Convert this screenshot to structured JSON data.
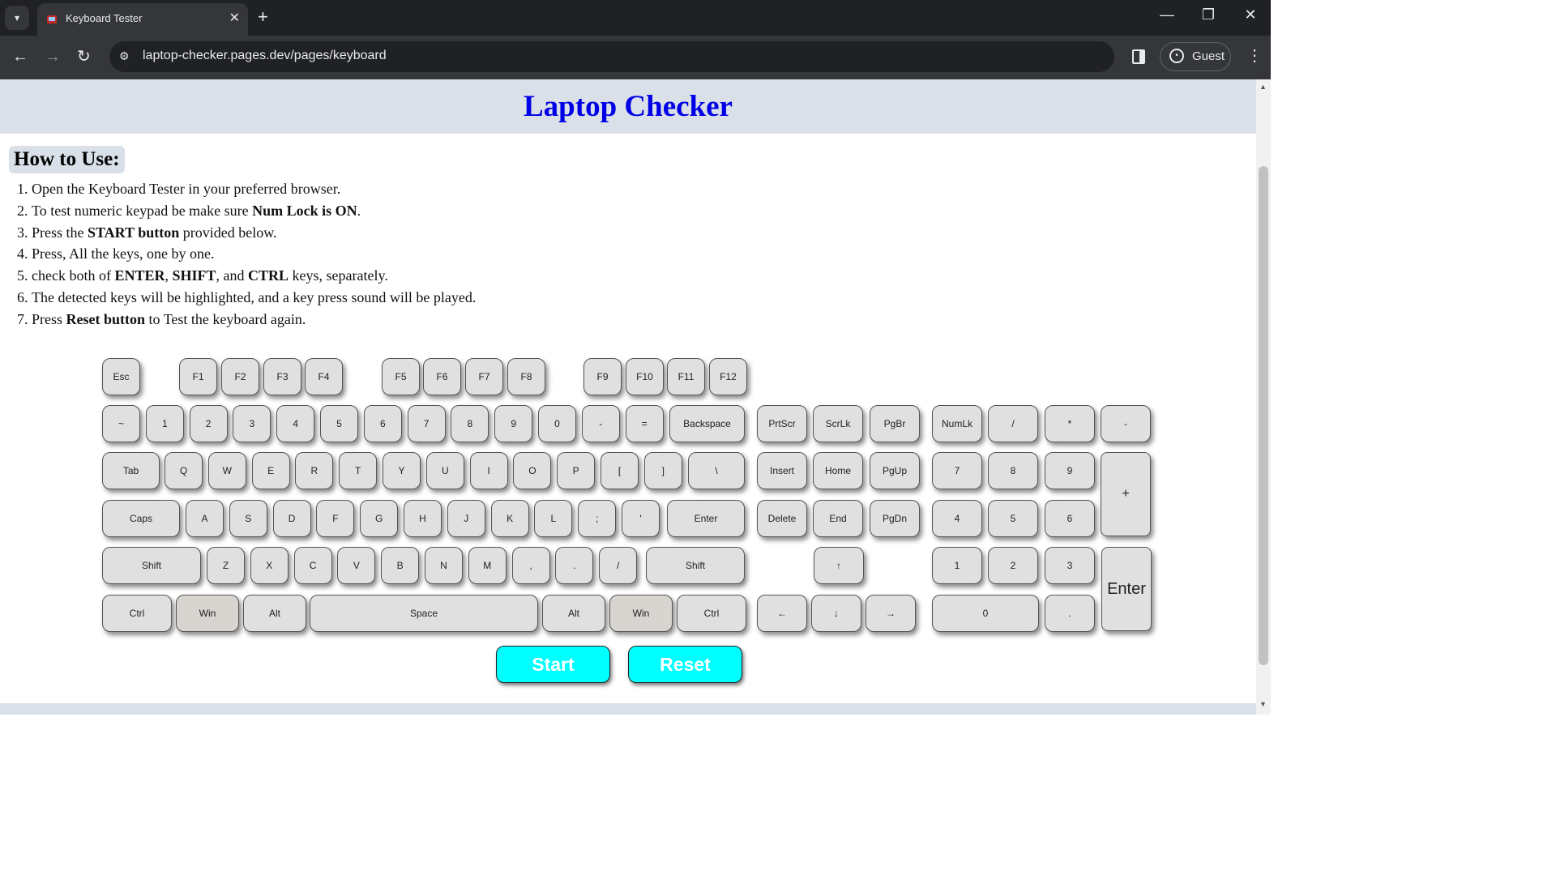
{
  "browser": {
    "tab_title": "Keyboard Tester",
    "tab_close": "✕",
    "new_tab": "+",
    "url": "laptop-checker.pages.dev/pages/keyboard",
    "profile_label": "Guest",
    "icons": [
      "tab-list-icon",
      "favicon",
      "close-icon",
      "plus-icon",
      "minimize-icon",
      "restore-icon",
      "window-close-icon",
      "back-icon",
      "forward-icon",
      "reload-icon",
      "site-info-icon",
      "side-panel-icon",
      "profile-icon",
      "menu-icon"
    ]
  },
  "page": {
    "title": "Laptop Checker",
    "howto_heading": "How to Use:",
    "steps": [
      [
        {
          "t": "Open the Keyboard Tester in your preferred browser."
        }
      ],
      [
        {
          "t": "To test numeric keypad be make sure "
        },
        {
          "b": "Num Lock is ON"
        },
        {
          "t": "."
        }
      ],
      [
        {
          "t": "Press the "
        },
        {
          "b": "START button"
        },
        {
          "t": " provided below."
        }
      ],
      [
        {
          "t": "Press, All the keys, one by one."
        }
      ],
      [
        {
          "t": "check both of "
        },
        {
          "b": "ENTER"
        },
        {
          "t": ", "
        },
        {
          "b": "SHIFT"
        },
        {
          "t": ", and "
        },
        {
          "b": "CTRL"
        },
        {
          "t": " keys, separately."
        }
      ],
      [
        {
          "t": "The detected keys will be highlighted, and a key press sound will be played."
        }
      ],
      [
        {
          "t": "Press "
        },
        {
          "b": "Reset button"
        },
        {
          "t": " to Test the keyboard again."
        }
      ]
    ],
    "keyboard": {
      "fn_row": [
        "Esc",
        "F1",
        "F2",
        "F3",
        "F4",
        "F5",
        "F6",
        "F7",
        "F8",
        "F9",
        "F10",
        "F11",
        "F12"
      ],
      "number_row": [
        "~",
        "1",
        "2",
        "3",
        "4",
        "5",
        "6",
        "7",
        "8",
        "9",
        "0",
        "-",
        "=",
        "Backspace"
      ],
      "tab_row": [
        "Tab",
        "Q",
        "W",
        "E",
        "R",
        "T",
        "Y",
        "U",
        "I",
        "O",
        "P",
        "[",
        "]",
        "\\"
      ],
      "caps_row": [
        "Caps",
        "A",
        "S",
        "D",
        "F",
        "G",
        "H",
        "J",
        "K",
        "L",
        ";",
        "'",
        "Enter"
      ],
      "shift_row": [
        "Shift",
        "Z",
        "X",
        "C",
        "V",
        "B",
        "N",
        "M",
        ",",
        ".",
        "/",
        "Shift"
      ],
      "bottom_row": [
        "Ctrl",
        "Win",
        "Alt",
        "Space",
        "Alt",
        "Win",
        "Ctrl"
      ],
      "nav_cluster": [
        "PrtScr",
        "ScrLk",
        "PgBr",
        "Insert",
        "Home",
        "PgUp",
        "Delete",
        "End",
        "PgDn"
      ],
      "arrows": [
        "↑",
        "←",
        "↓",
        "→"
      ],
      "numpad": [
        "NumLk",
        "/",
        "*",
        "-",
        "7",
        "8",
        "9",
        "+",
        "4",
        "5",
        "6",
        "1",
        "2",
        "3",
        "Enter",
        "0",
        "."
      ]
    },
    "buttons": {
      "start": "Start",
      "reset": "Reset"
    }
  },
  "colors": {
    "title": "#0000e6",
    "header_bg": "#d9e0e8",
    "button_bg": "#00ffff",
    "key_bg": "#e0e0e0"
  }
}
